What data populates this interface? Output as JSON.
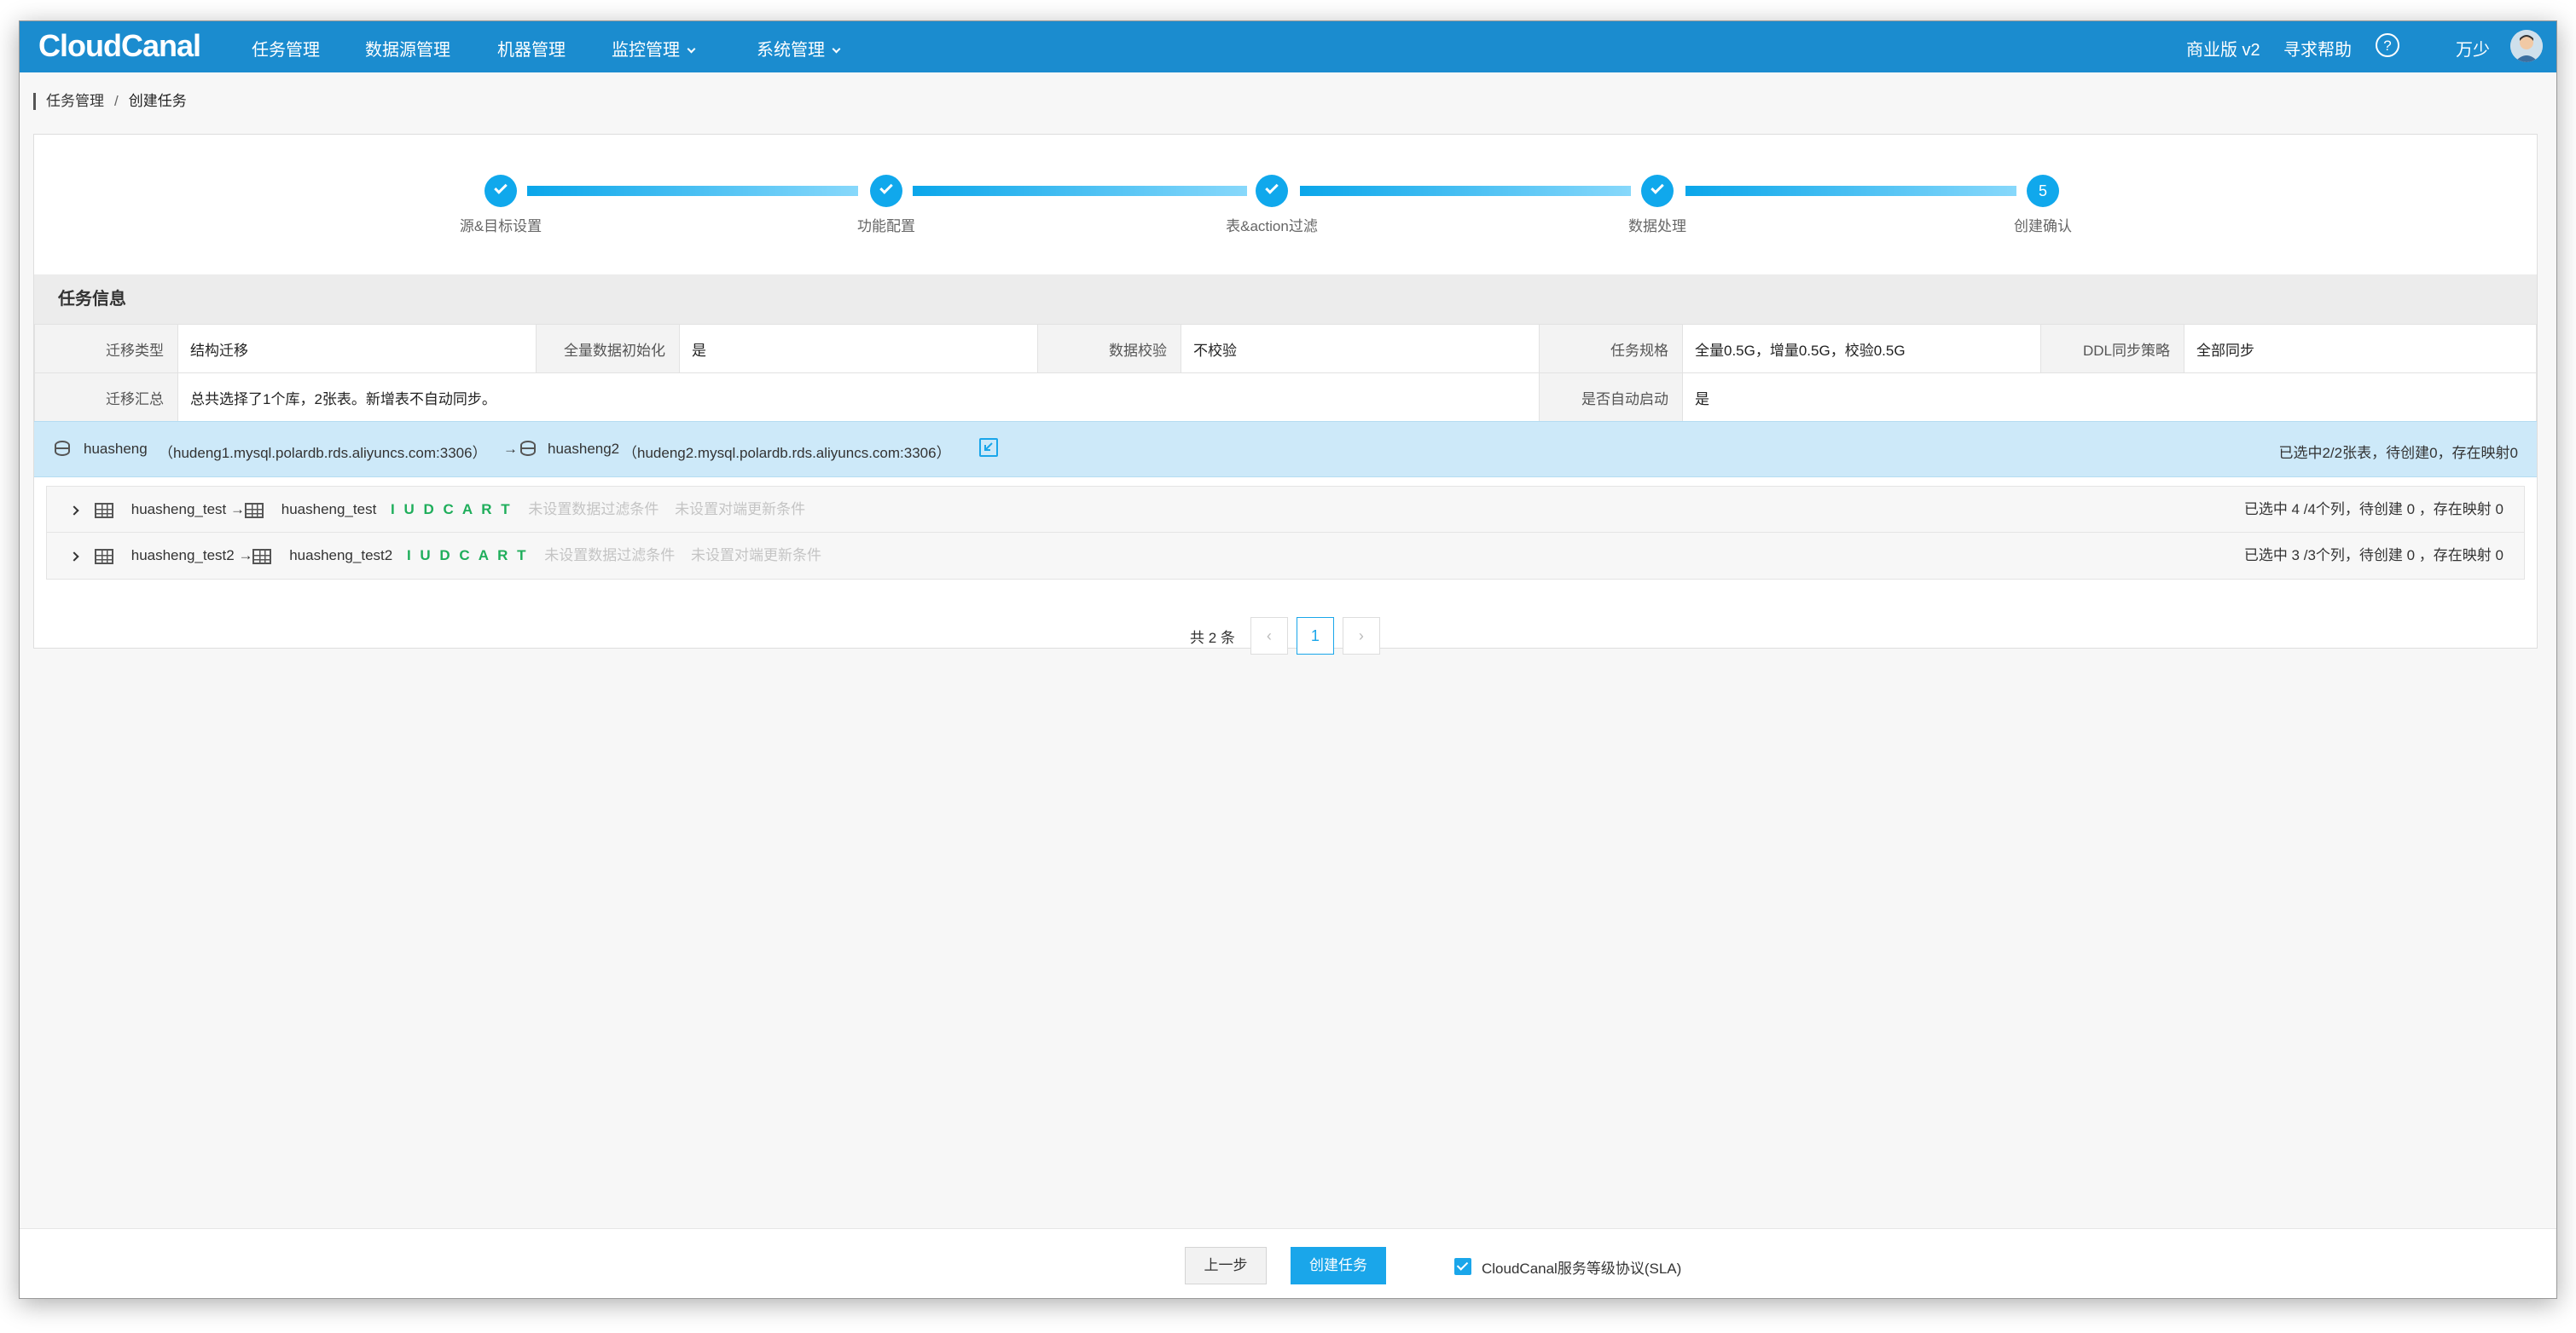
{
  "app": {
    "logo": "CloudCanal"
  },
  "nav": {
    "items": [
      {
        "label": "任务管理",
        "dropdown": false
      },
      {
        "label": "数据源管理",
        "dropdown": false
      },
      {
        "label": "机器管理",
        "dropdown": false
      },
      {
        "label": "监控管理",
        "dropdown": true
      },
      {
        "label": "系统管理",
        "dropdown": true
      }
    ],
    "edition": "商业版 v2",
    "help": "寻求帮助",
    "help_icon": "?",
    "user": "万少"
  },
  "breadcrumb": {
    "parent": "任务管理",
    "separator": "/",
    "current": "创建任务"
  },
  "steps": [
    {
      "label": "源&目标设置",
      "state": "done"
    },
    {
      "label": "功能配置",
      "state": "done"
    },
    {
      "label": "表&action过滤",
      "state": "done"
    },
    {
      "label": "数据处理",
      "state": "done"
    },
    {
      "label": "创建确认",
      "state": "current",
      "number": "5"
    }
  ],
  "task_info": {
    "title": "任务信息",
    "row1": [
      {
        "key": "迁移类型",
        "value": "结构迁移"
      },
      {
        "key": "全量数据初始化",
        "value": "是"
      },
      {
        "key": "数据校验",
        "value": "不校验"
      },
      {
        "key": "任务规格",
        "value": "全量0.5G，增量0.5G，校验0.5G"
      },
      {
        "key": "DDL同步策略",
        "value": "全部同步"
      }
    ],
    "row2": [
      {
        "key": "迁移汇总",
        "value": "总共选择了1个库，2张表。新增表不自动同步。"
      },
      {
        "key": "是否自动启动",
        "value": "是"
      }
    ]
  },
  "mapping": {
    "source_db": "huasheng",
    "source_host": "（hudeng1.mysql.polardb.rds.aliyuncs.com:3306）",
    "arrow": "→",
    "target_db": "huasheng2",
    "target_host": "（hudeng2.mysql.polardb.rds.aliyuncs.com:3306）",
    "summary": "已选中2/2张表，待创建0，存在映射0"
  },
  "tables": [
    {
      "source": "huasheng_test",
      "target": "huasheng_test",
      "actions": "I U D C A R T",
      "filter": "未设置数据过滤条件",
      "update": "未设置对端更新条件",
      "summary": "已选中 4 /4个列，待创建 0 ，存在映射 0"
    },
    {
      "source": "huasheng_test2",
      "target": "huasheng_test2",
      "actions": "I U D C A R T",
      "filter": "未设置数据过滤条件",
      "update": "未设置对端更新条件",
      "summary": "已选中 3 /3个列，待创建 0 ，存在映射 0"
    }
  ],
  "pagination": {
    "total": "共 2 条",
    "prev": "‹",
    "page": "1",
    "next": "›"
  },
  "footer": {
    "prev": "上一步",
    "create": "创建任务",
    "sla": "CloudCanal服务等级协议(SLA)",
    "sla_checked": true
  },
  "colors": {
    "nav_bg": "#1b8ccf",
    "accent": "#1aa6ea",
    "action_green": "#1fae5b",
    "mapping_bg": "#cde9f9"
  }
}
